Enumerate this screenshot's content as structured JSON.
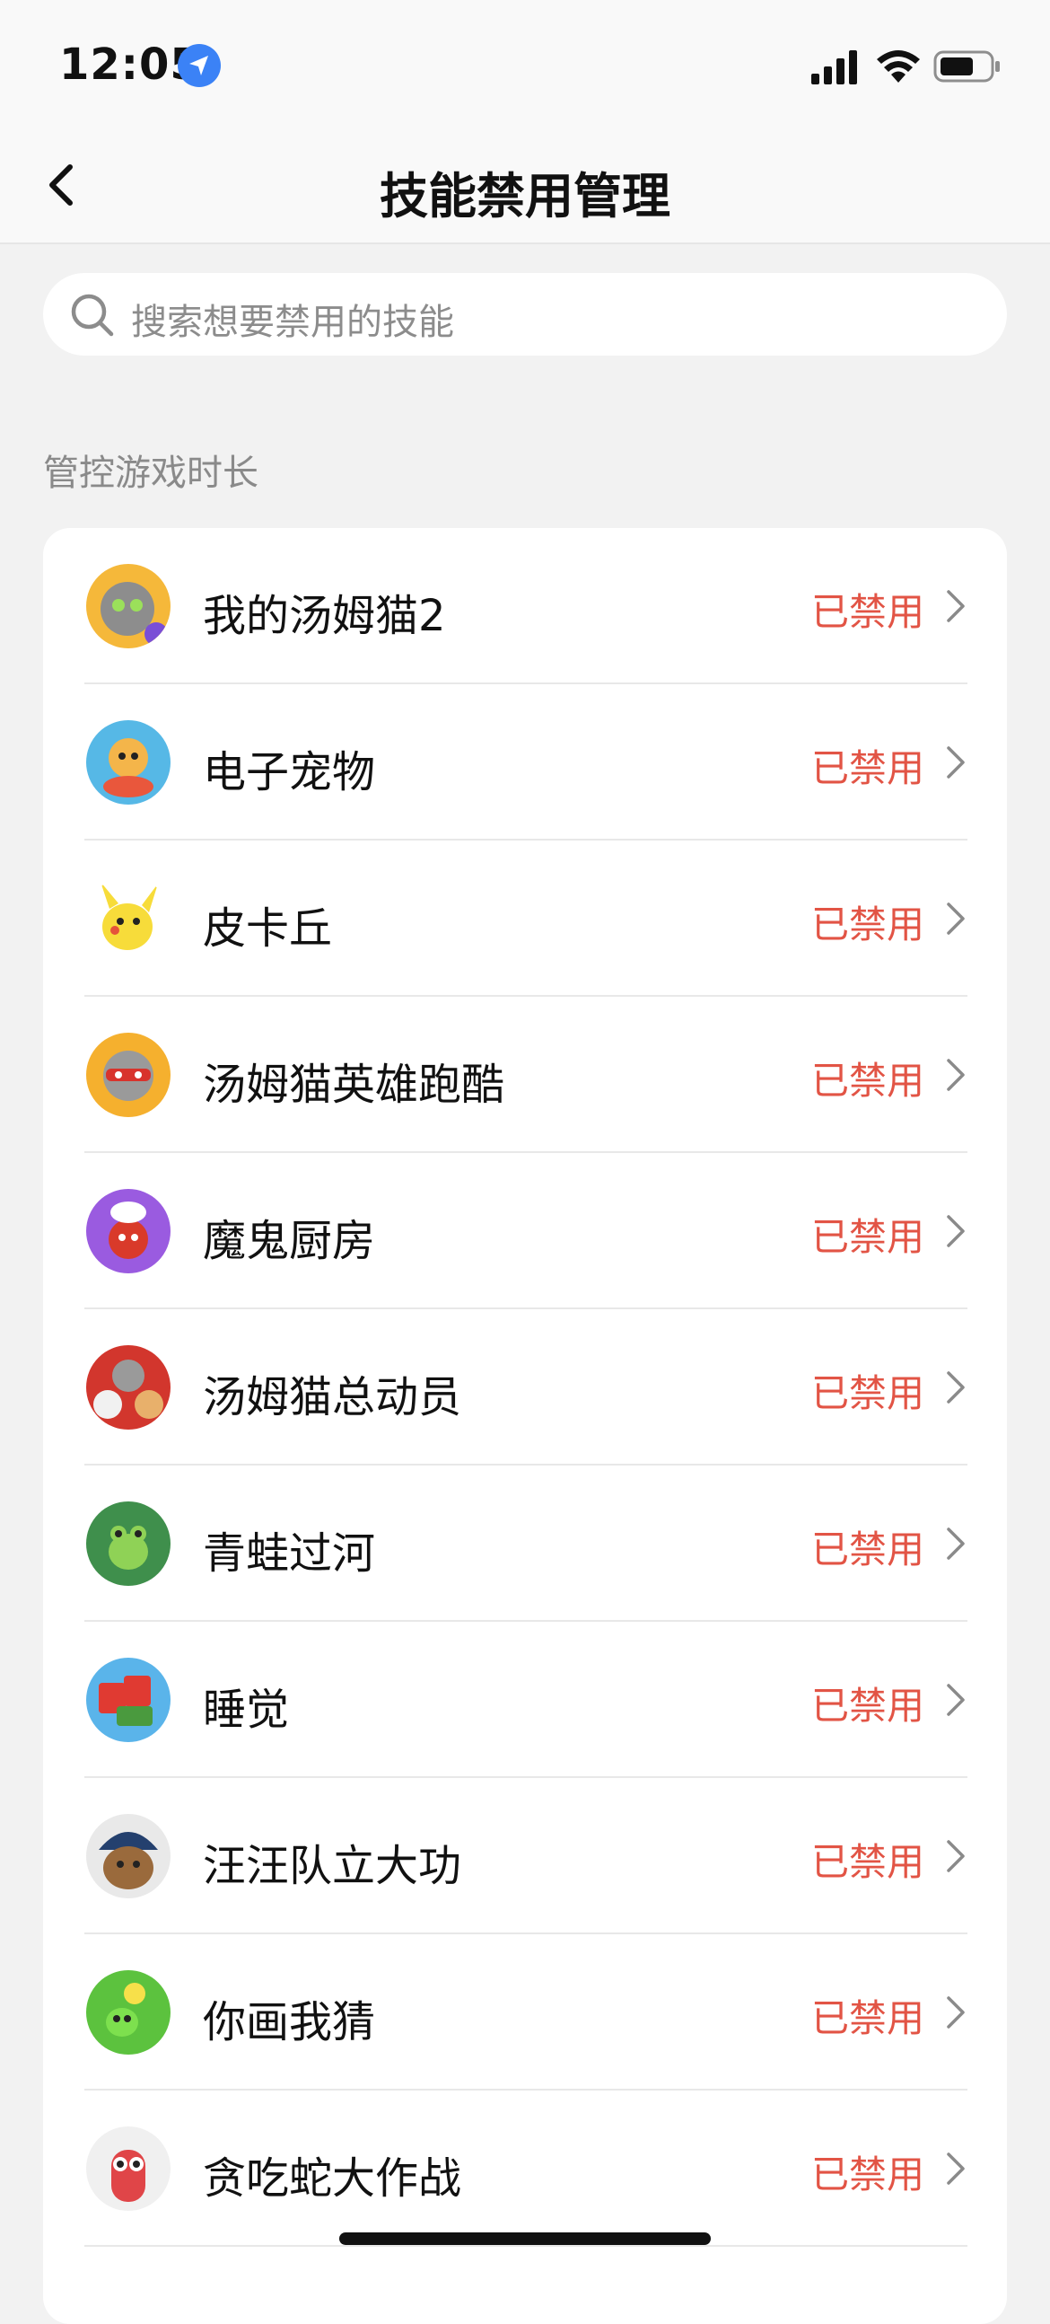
{
  "status_bar": {
    "time": "12:05"
  },
  "nav": {
    "title": "技能禁用管理"
  },
  "search": {
    "placeholder": "搜索想要禁用的技能"
  },
  "section": {
    "label": "管控游戏时长"
  },
  "colors": {
    "accent_red": "#e25445",
    "background": "#f2f2f2",
    "card": "#ffffff"
  },
  "items": [
    {
      "name": "我的汤姆猫2",
      "status": "已禁用",
      "icon": "talking-tom-2-icon"
    },
    {
      "name": "电子宠物",
      "status": "已禁用",
      "icon": "electronic-pet-icon"
    },
    {
      "name": "皮卡丘",
      "status": "已禁用",
      "icon": "pikachu-icon"
    },
    {
      "name": "汤姆猫英雄跑酷",
      "status": "已禁用",
      "icon": "tom-hero-dash-icon"
    },
    {
      "name": "魔鬼厨房",
      "status": "已禁用",
      "icon": "devil-kitchen-icon"
    },
    {
      "name": "汤姆猫总动员",
      "status": "已禁用",
      "icon": "tom-friends-icon"
    },
    {
      "name": "青蛙过河",
      "status": "已禁用",
      "icon": "frog-crossing-icon"
    },
    {
      "name": "睡觉",
      "status": "已禁用",
      "icon": "sleep-icon"
    },
    {
      "name": "汪汪队立大功",
      "status": "已禁用",
      "icon": "paw-patrol-icon"
    },
    {
      "name": "你画我猜",
      "status": "已禁用",
      "icon": "draw-guess-icon"
    },
    {
      "name": "贪吃蛇大作战",
      "status": "已禁用",
      "icon": "snake-battle-icon"
    }
  ]
}
